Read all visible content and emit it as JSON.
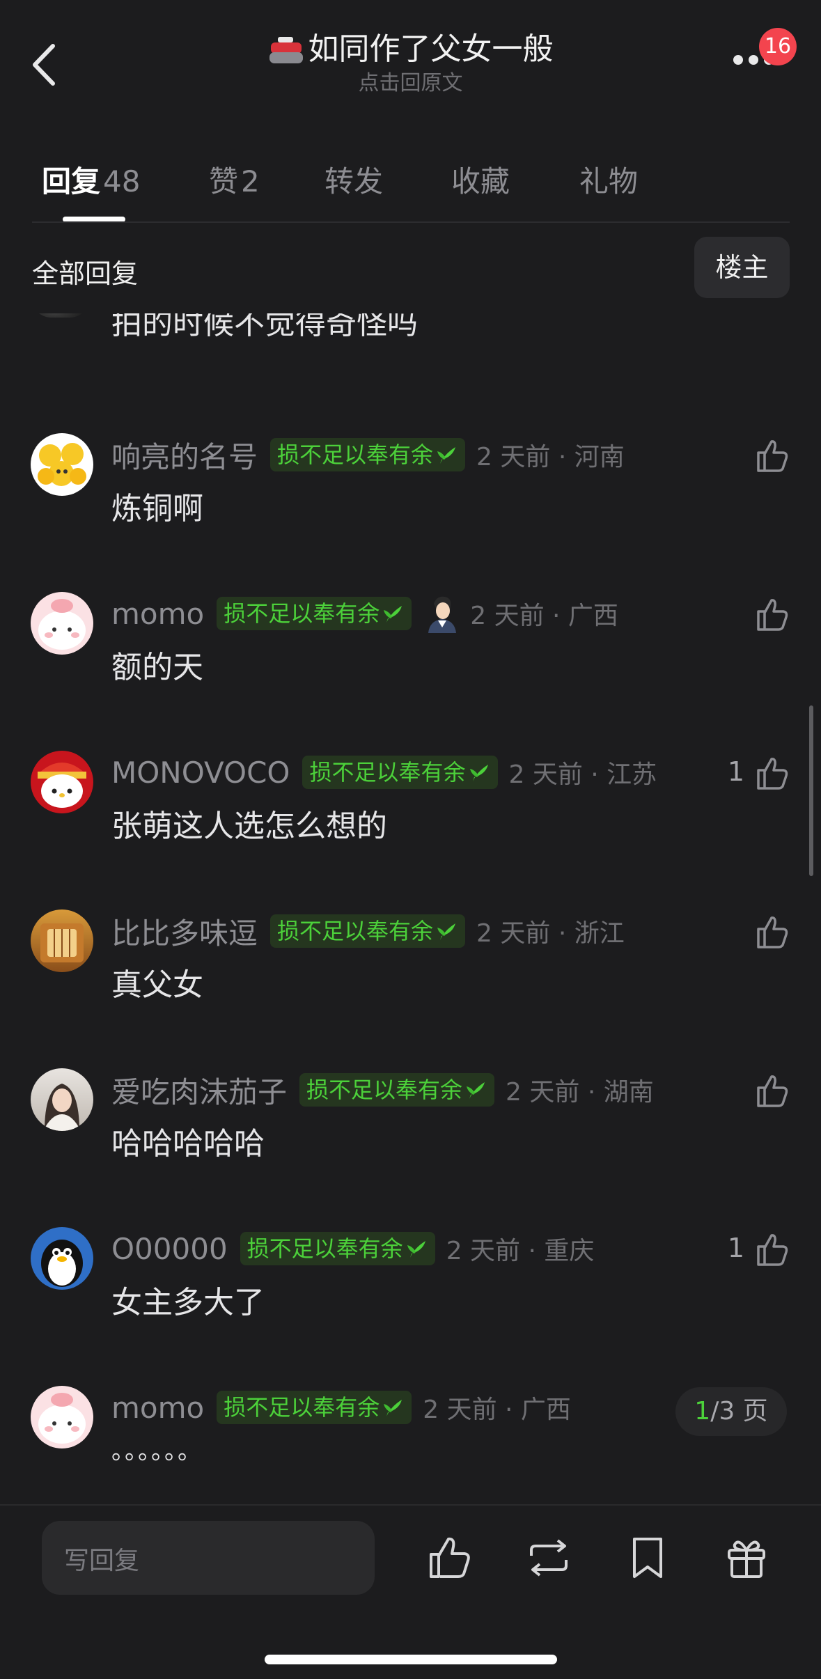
{
  "header": {
    "title": "如同作了父女一般",
    "subtitle": "点击回原文",
    "notification_count": "16"
  },
  "tabs": [
    {
      "label": "回复",
      "count": "48"
    },
    {
      "label": "赞",
      "count": "2"
    },
    {
      "label": "转发",
      "count": ""
    },
    {
      "label": "收藏",
      "count": ""
    },
    {
      "label": "礼物",
      "count": ""
    }
  ],
  "filter": {
    "all_replies": "全部回复",
    "op_only": "楼主"
  },
  "comments": [
    {
      "username": "",
      "tag": "",
      "time": "",
      "text": "拍的时候不觉得奇怪吗",
      "likes": ""
    },
    {
      "username": "响亮的名号",
      "tag": "损不足以奉有余",
      "time": "2 天前 · 河南",
      "text": "炼铜啊",
      "likes": ""
    },
    {
      "username": "momo",
      "tag": "损不足以奉有余",
      "time": "2 天前 · 广西",
      "text": "额的天",
      "likes": ""
    },
    {
      "username": "MONOVOCO",
      "tag": "损不足以奉有余",
      "time": "2 天前 · 江苏",
      "text": "张萌这人选怎么想的",
      "likes": "1"
    },
    {
      "username": "比比多味逗",
      "tag": "损不足以奉有余",
      "time": "2 天前 · 浙江",
      "text": "真父女",
      "likes": ""
    },
    {
      "username": "爱吃肉沫茄子",
      "tag": "损不足以奉有余",
      "time": "2 天前 · 湖南",
      "text": "哈哈哈哈哈",
      "likes": ""
    },
    {
      "username": "O00000",
      "tag": "损不足以奉有余",
      "time": "2 天前 · 重庆",
      "text": "女主多大了",
      "likes": "1"
    },
    {
      "username": "momo",
      "tag": "损不足以奉有余",
      "time": "2 天前 · 广西",
      "text": "。。。。。。",
      "likes": ""
    }
  ],
  "pager": {
    "current": "1",
    "total": "/3 页"
  },
  "bottom": {
    "reply_placeholder": "写回复"
  },
  "colors": {
    "background": "#1c1c1e",
    "tag_green": "#4cd13a",
    "badge_red": "#f3444e"
  }
}
